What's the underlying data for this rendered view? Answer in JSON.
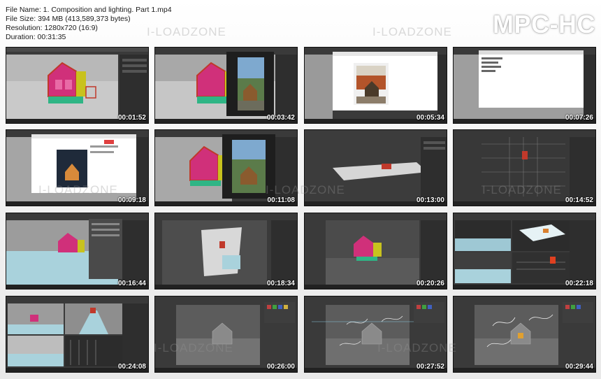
{
  "file_info": {
    "file_name": "File Name: 1. Composition and lighting. Part 1.mp4",
    "file_size": "File Size: 394 MB (413,589,373 bytes)",
    "resolution": "Resolution: 1280x720 (16:9)",
    "duration": "Duration: 00:31:35"
  },
  "brand": "MPC-HC",
  "watermark": "I-LOADZONE",
  "thumbnails": [
    {
      "timestamp": "00:01:52",
      "scene": "pink-cabin-viewport"
    },
    {
      "timestamp": "00:03:42",
      "scene": "cabin-with-reference-photo"
    },
    {
      "timestamp": "00:05:34",
      "scene": "browser-reference-image"
    },
    {
      "timestamp": "00:07:26",
      "scene": "white-dialog-window"
    },
    {
      "timestamp": "00:09:18",
      "scene": "browser-dark-reference"
    },
    {
      "timestamp": "00:11:08",
      "scene": "cabin-with-reference-photo-2"
    },
    {
      "timestamp": "00:13:00",
      "scene": "terrain-plane"
    },
    {
      "timestamp": "00:14:52",
      "scene": "wireframe-top-view"
    },
    {
      "timestamp": "00:16:44",
      "scene": "cabin-with-settings-panel"
    },
    {
      "timestamp": "00:18:34",
      "scene": "terrain-grid-view"
    },
    {
      "timestamp": "00:20:26",
      "scene": "cabin-perspective-dark"
    },
    {
      "timestamp": "00:22:18",
      "scene": "multi-viewport-layout"
    },
    {
      "timestamp": "00:24:08",
      "scene": "multi-viewport-layout-2"
    },
    {
      "timestamp": "00:26:00",
      "scene": "grey-render-cabin"
    },
    {
      "timestamp": "00:27:52",
      "scene": "render-with-trees"
    },
    {
      "timestamp": "00:29:44",
      "scene": "render-with-trees-lit"
    }
  ],
  "colors": {
    "viewport_bg": "#3c3c3c",
    "panel_bg": "#2e2e2e",
    "cabin_pink": "#d0307a",
    "cabin_yellow": "#c8c21e",
    "cabin_red": "#c0392b",
    "water_cyan": "#a9d2dc",
    "grass_green": "#2fb585"
  }
}
